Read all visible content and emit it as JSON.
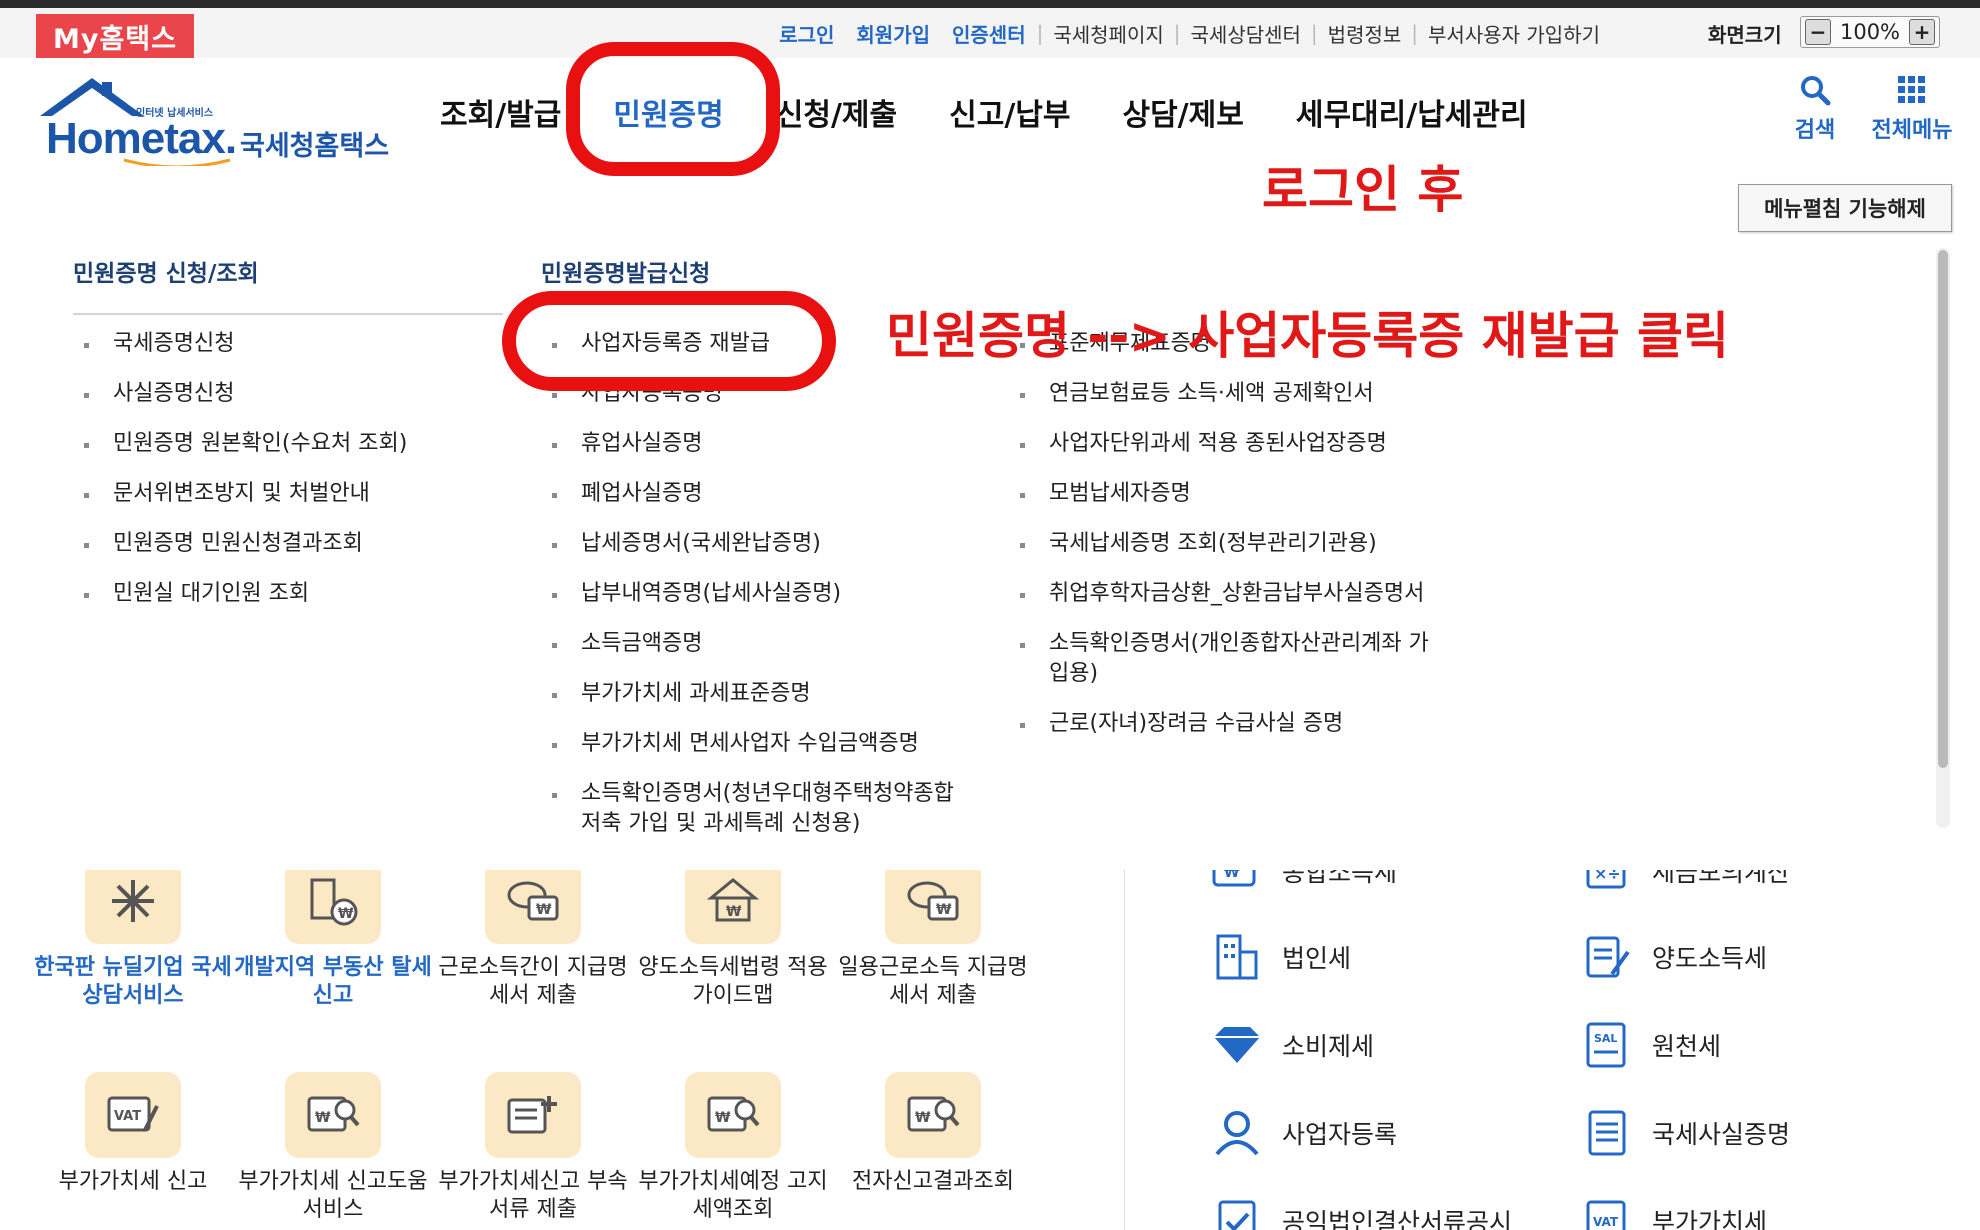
{
  "utility": {
    "my_hometax": "My홈택스",
    "links_blue": [
      "로그인",
      "회원가입",
      "인증센터"
    ],
    "links": [
      "국세청페이지",
      "국세상담센터",
      "법령정보",
      "부서사용자 가입하기"
    ],
    "screen_size_label": "화면크기",
    "zoom_value": "100%",
    "zoom_minus": "−",
    "zoom_plus": "+"
  },
  "logo": {
    "small": "인터넷 납세서비스",
    "main": "Hometax.",
    "korean": "국세청홈택스"
  },
  "gnb": {
    "items": [
      "조회/발급",
      "민원증명",
      "신청/제출",
      "신고/납부",
      "상담/제보",
      "세무대리/납세관리"
    ],
    "active": "민원증명"
  },
  "header_right": {
    "search_label": "검색",
    "allmenu_label": "전체메뉴"
  },
  "mega": {
    "fold_button": "메뉴펼침 기능해제",
    "col1": {
      "title": "민원증명 신청/조회",
      "items": [
        "국세증명신청",
        "사실증명신청",
        "민원증명 원본확인(수요처 조회)",
        "문서위변조방지 및 처벌안내",
        "민원증명 민원신청결과조회",
        "민원실 대기인원 조회"
      ]
    },
    "col2": {
      "title": "민원증명발급신청",
      "items": [
        "사업자등록증 재발급",
        "사업자등록증명",
        "휴업사실증명",
        "폐업사실증명",
        "납세증명서(국세완납증명)",
        "납부내역증명(납세사실증명)",
        "소득금액증명",
        "부가가치세 과세표준증명",
        "부가가치세 면세사업자 수입금액증명",
        "소득확인증명서(청년우대형주택청약종합저축 가입 및 과세특례 신청용)"
      ]
    },
    "col3": {
      "items": [
        "표준재무제표증명",
        "연금보험료등 소득·세액 공제확인서",
        "사업자단위과세 적용 종된사업장증명",
        "모범납세자증명",
        "국세납세증명 조회(정부관리기관용)",
        "취업후학자금상환_상환금납부사실증명서",
        "소득확인증명서(개인종합자산관리계좌 가입용)",
        "근로(자녀)장려금 수급사실 증명"
      ]
    }
  },
  "lower": {
    "services_row1": [
      {
        "label": "한국판 뉴딜기업 국세상담서비스",
        "blue": true,
        "icon": "newdeal-icon"
      },
      {
        "label": "개발지역 부동산 탈세신고",
        "blue": true,
        "icon": "building-money-icon"
      },
      {
        "label": "근로소득간이 지급명세서 제출",
        "blue": false,
        "icon": "coin-document-icon"
      },
      {
        "label": "양도소득세법령 적용가이드맵",
        "blue": false,
        "icon": "house-money-icon"
      },
      {
        "label": "일용근로소득 지급명세서 제출",
        "blue": false,
        "icon": "coin-document-icon"
      }
    ],
    "services_row2": [
      {
        "label": "부가가치세 신고",
        "icon": "vat-icon"
      },
      {
        "label": "부가가치세 신고도움 서비스",
        "icon": "search-doc-icon"
      },
      {
        "label": "부가가치세신고 부속서류 제출",
        "icon": "doc-plus-icon"
      },
      {
        "label": "부가가치세예정 고지세액조회",
        "icon": "search-doc-icon"
      },
      {
        "label": "전자신고결과조회",
        "icon": "search-doc-icon"
      }
    ],
    "tax_left": [
      "종합소득세",
      "법인세",
      "소비제세",
      "사업자등록",
      "공익법인결산서류공시"
    ],
    "tax_right": [
      "세금모의계산",
      "양도소득세",
      "원천세",
      "국세사실증명",
      "부가가치세"
    ]
  },
  "annotations": {
    "after_login": "로그인 후",
    "instruction": "민원증명 --> 사업자등록증 재발급 클릭"
  },
  "colors": {
    "accent_blue": "#2368c4",
    "annotation_red": "#e01818",
    "my_hometax_red": "#e9454a"
  }
}
